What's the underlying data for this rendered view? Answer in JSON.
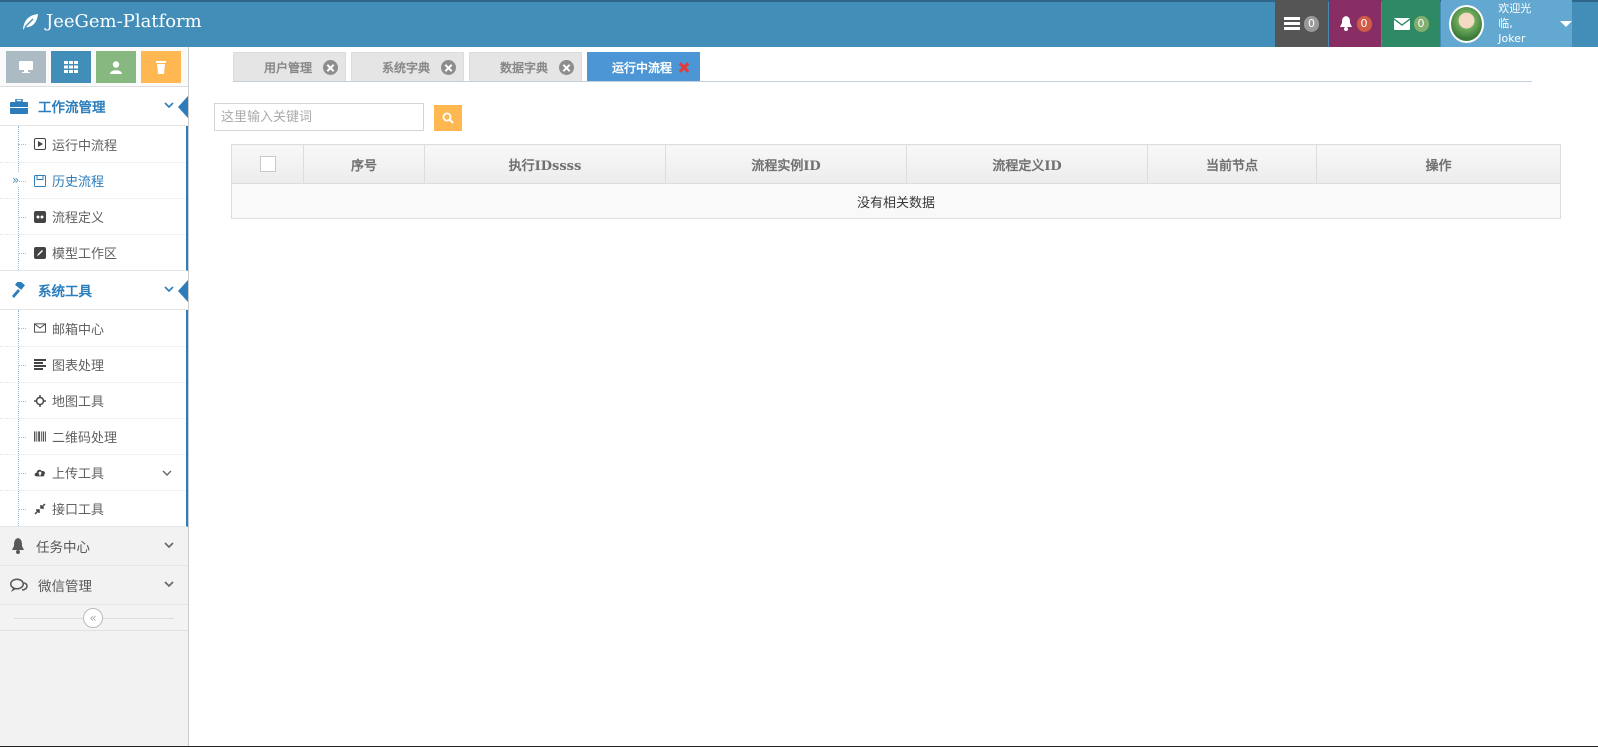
{
  "app": {
    "brand": "JeeGem-Platform"
  },
  "navbar": {
    "tasks_count": "0",
    "notifications_count": "0",
    "messages_count": "0",
    "user_greeting": "欢迎光临,",
    "user_name": "Joker"
  },
  "sidebar": {
    "groups": [
      {
        "label": "工作流管理",
        "items": [
          "运行中流程",
          "历史流程",
          "流程定义",
          "模型工作区"
        ]
      },
      {
        "label": "系统工具",
        "items": [
          "邮箱中心",
          "图表处理",
          "地图工具",
          "二维码处理",
          "上传工具",
          "接口工具"
        ]
      },
      {
        "label": "任务中心"
      },
      {
        "label": "微信管理"
      }
    ]
  },
  "tabs": [
    "用户管理",
    "系统字典",
    "数据字典",
    "运行中流程"
  ],
  "search": {
    "placeholder": "这里输入关键词"
  },
  "table": {
    "columns": [
      "序号",
      "执行IDssss",
      "流程实例ID",
      "流程定义ID",
      "当前节点",
      "操作"
    ],
    "empty_text": "没有相关数据"
  }
}
